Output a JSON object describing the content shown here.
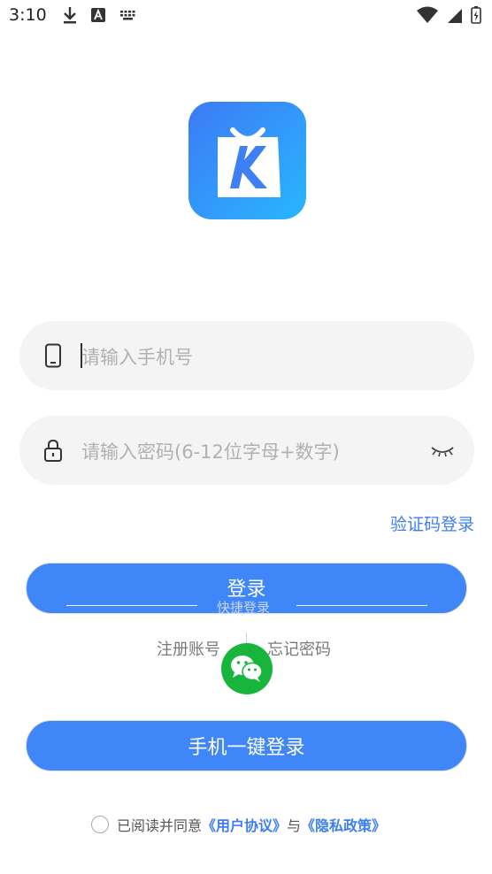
{
  "status_bar": {
    "time": "3:10",
    "left_icons": [
      "download-icon",
      "font-icon",
      "keyboard-icon"
    ],
    "right_icons": [
      "wifi-icon",
      "signal-icon",
      "battery-icon"
    ]
  },
  "logo": {
    "letter": "K"
  },
  "phone_input": {
    "placeholder": "请输入手机号",
    "icon": "phone-icon"
  },
  "password_input": {
    "placeholder": "请输入密码(6-12位字母+数字)",
    "icon": "lock-icon",
    "toggle_icon": "eye-closed-icon"
  },
  "code_login_link": "验证码登录",
  "login_button": "登录",
  "quick_login_label": "快捷登录",
  "register_link": "注册账号",
  "forgot_link": "忘记密码",
  "wechat_icon": "wechat-icon",
  "one_key_button": "手机一键登录",
  "agreement": {
    "prefix": "已阅读并同意",
    "user_agreement": "《用户协议》",
    "and": "与",
    "privacy_policy": "《隐私政策》"
  },
  "colors": {
    "accent": "#3f86f8",
    "link": "#3e7ff0",
    "wechat": "#18b53c"
  }
}
